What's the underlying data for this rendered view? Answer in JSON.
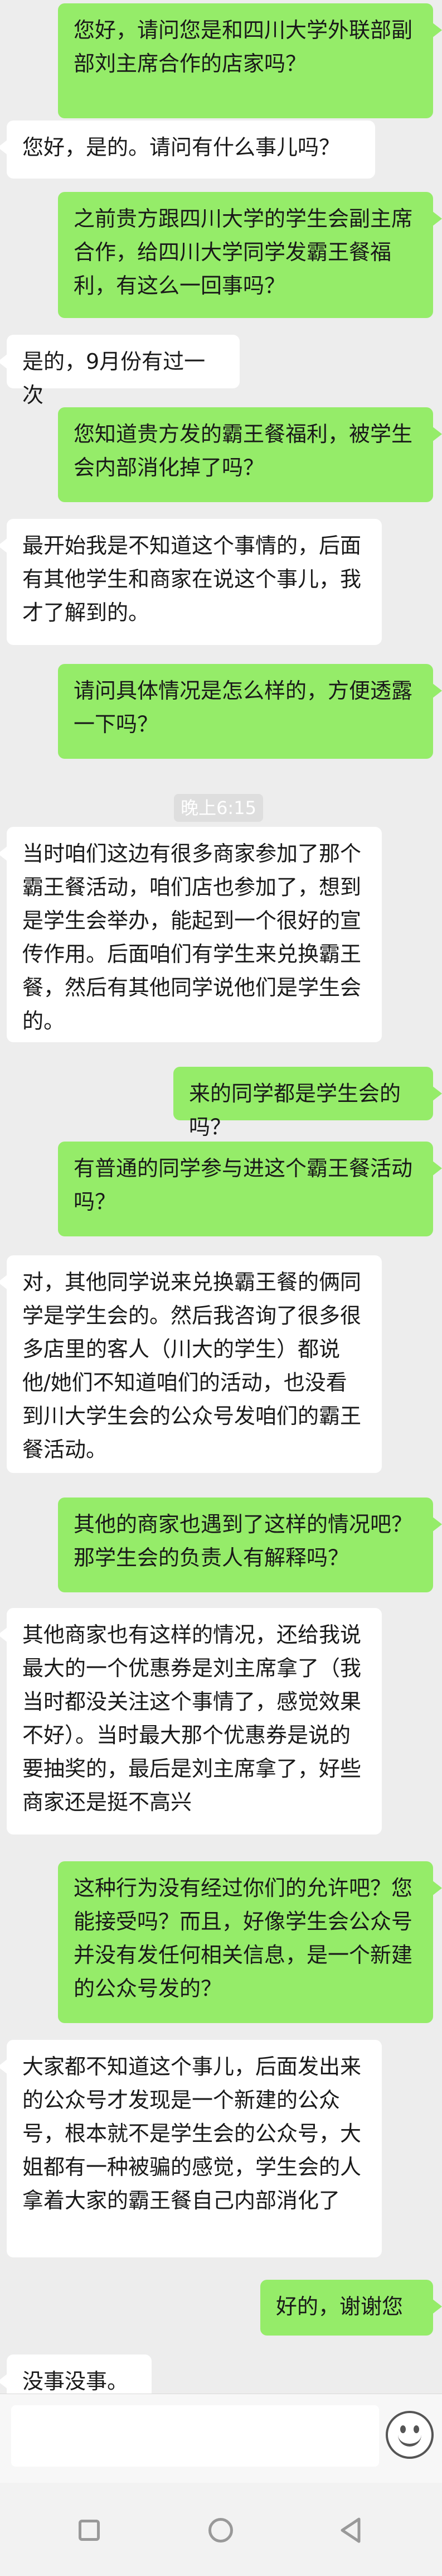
{
  "conversation": {
    "messages": [
      {
        "side": "me",
        "text": "您好，请问您是和四川大学外联部副部刘主席合作的店家吗？"
      },
      {
        "side": "other",
        "text": "您好，是的。请问有什么事儿吗？"
      },
      {
        "side": "me",
        "text": "之前贵方跟四川大学的学生会副主席合作，给四川大学同学发霸王餐福利，有这么一回事吗？"
      },
      {
        "side": "other",
        "text": "是的，9月份有过一次"
      },
      {
        "side": "me",
        "text": "您知道贵方发的霸王餐福利，被学生会内部消化掉了吗？"
      },
      {
        "side": "other",
        "text": "最开始我是不知道这个事情的，后面有其他学生和商家在说这个事儿，我才了解到的。"
      },
      {
        "side": "me",
        "text": "请问具体情况是怎么样的，方便透露一下吗？"
      },
      {
        "side": "other",
        "text": "当时咱们这边有很多商家参加了那个霸王餐活动，咱们店也参加了，想到是学生会举办，能起到一个很好的宣传作用。后面咱们有学生来兑换霸王餐，然后有其他同学说他们是学生会的。"
      },
      {
        "side": "me",
        "text": "来的同学都是学生会的吗？"
      },
      {
        "side": "me",
        "text": "有普通的同学参与进这个霸王餐活动吗？"
      },
      {
        "side": "other",
        "text": "对，其他同学说来兑换霸王餐的俩同学是学生会的。然后我咨询了很多很多店里的客人（川大的学生）都说他/她们不知道咱们的活动，也没看到川大学生会的公众号发咱们的霸王餐活动。"
      },
      {
        "side": "me",
        "text": "其他的商家也遇到了这样的情况吧？那学生会的负责人有解释吗？"
      },
      {
        "side": "other",
        "text": "其他商家也有这样的情况，还给我说最大的一个优惠券是刘主席拿了（我当时都没关注这个事情了，感觉效果不好）。当时最大那个优惠券是说的要抽奖的，最后是刘主席拿了，好些商家还是挺不高兴"
      },
      {
        "side": "me",
        "text": "这种行为没有经过你们的允许吧？您能接受吗？而且，好像学生会公众号并没有发任何相关信息，是一个新建的公众号发的？"
      },
      {
        "side": "other",
        "text": "大家都不知道这个事儿，后面发出来的公众号才发现是一个新建的公众号，根本就不是学生会的公众号，大姐都有一种被骗的感觉，学生会的人拿着大家的霸王餐自己内部消化了"
      },
      {
        "side": "me",
        "text": "好的，谢谢您"
      },
      {
        "side": "other",
        "text": "没事没事。"
      }
    ],
    "timestamp": "晚上6:15"
  },
  "input_bar": {
    "emoji_icon": "smiley-face-icon"
  },
  "nav_bar": {
    "icons": [
      "recent-apps-icon",
      "home-icon",
      "back-icon"
    ]
  },
  "colors": {
    "me_bubble": "#95ec69",
    "other_bubble": "#ffffff",
    "background": "#ededed"
  }
}
